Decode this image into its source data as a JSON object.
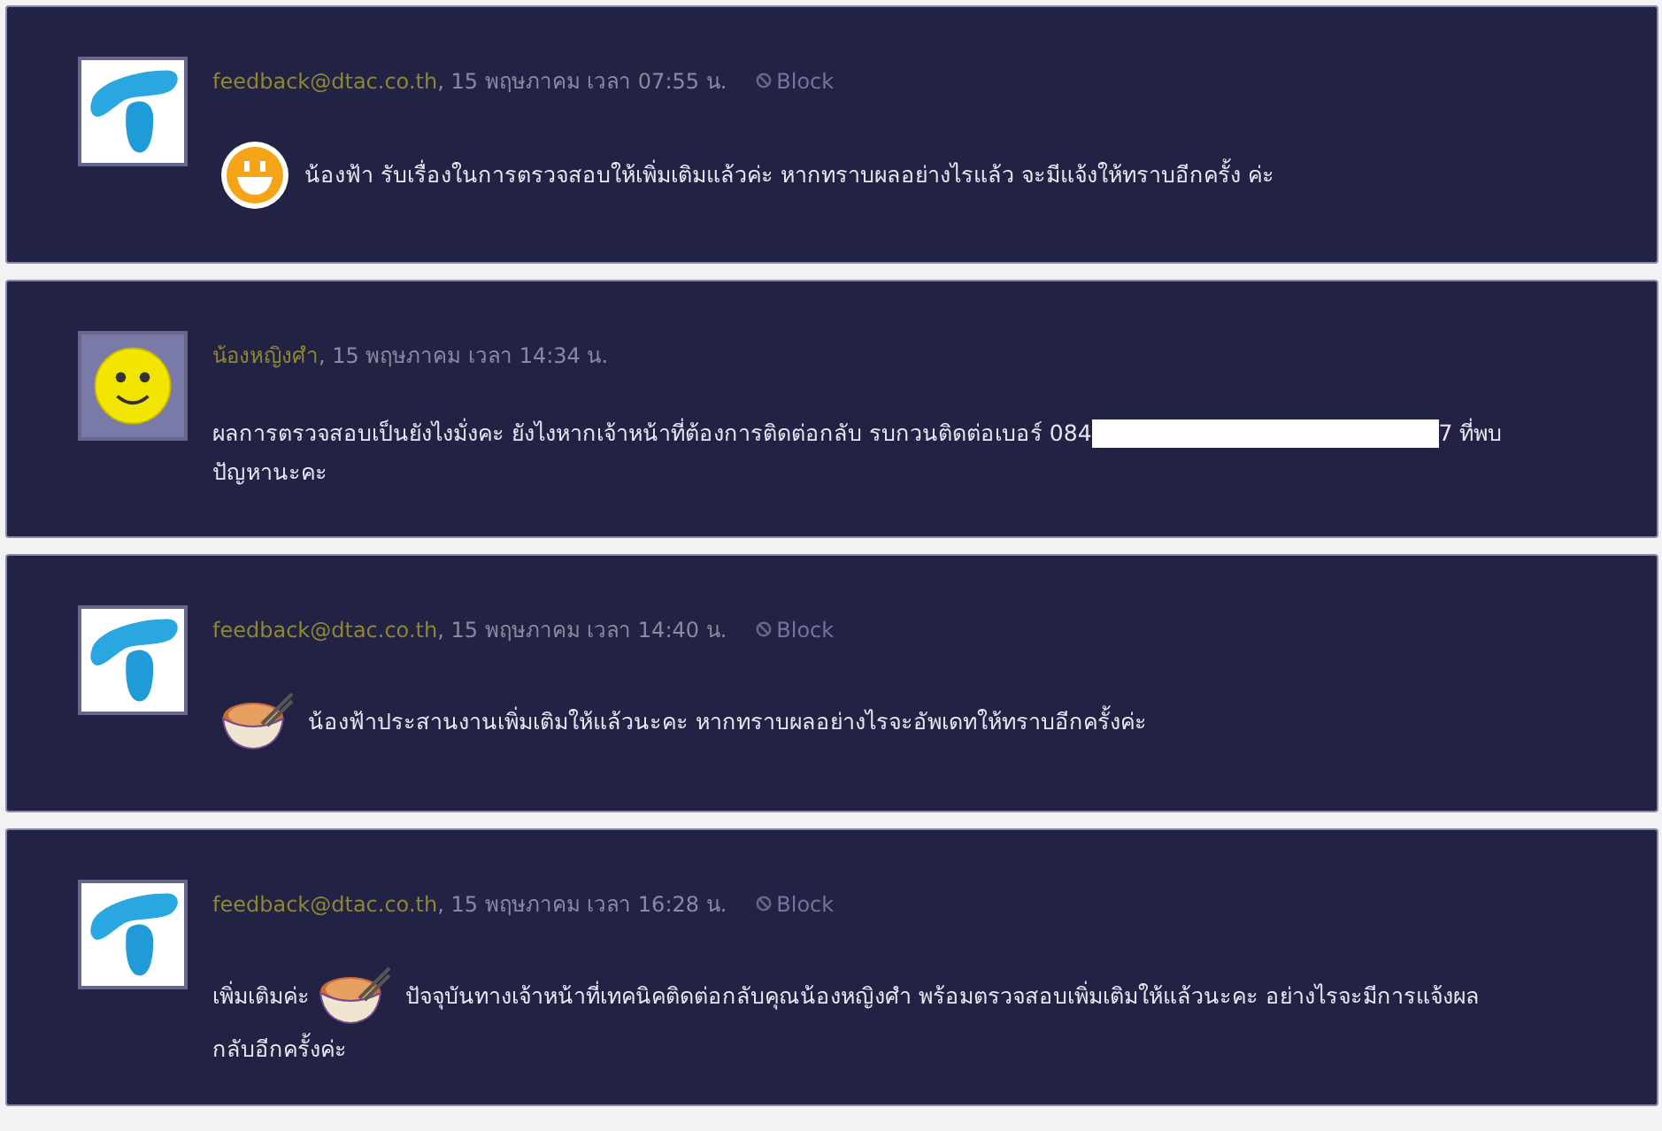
{
  "posts": [
    {
      "avatar": {
        "kind": "logo"
      },
      "author": "feedback@dtac.co.th",
      "date": ", 15 พฤษภาคม เวลา 07:55 น.",
      "block": "Block",
      "lines": [
        [
          {
            "kind": "grin"
          },
          {
            "kind": "text",
            "text": "น้องฟ้า รับเรื่องในการตรวจสอบให้เพิ่มเติมแล้วค่ะ หากทราบผลอย่างไรแล้ว จะมีแจ้งให้ทราบอีกครั้ง ค่ะ"
          }
        ]
      ]
    },
    {
      "avatar": {
        "kind": "smiley"
      },
      "author": "น้องหญิงศำ",
      "date": ", 15 พฤษภาคม เวลา 14:34 น.",
      "lines": [
        [
          {
            "kind": "text",
            "text": "ผลการตรวจสอบเป็นยังไงมั่งคะ ยังไงหากเจ้าหน้าที่ต้องการติดต่อกลับ รบกวนติดต่อเบอร์ 084"
          },
          {
            "kind": "redacted"
          },
          {
            "kind": "text",
            "text": "7 ที่พบ"
          }
        ],
        [
          {
            "kind": "text",
            "text": "ปัญหานะคะ"
          }
        ]
      ]
    },
    {
      "avatar": {
        "kind": "logo"
      },
      "author": "feedback@dtac.co.th",
      "date": ", 15 พฤษภาคม เวลา 14:40 น.",
      "block": "Block",
      "lines": [
        [
          {
            "kind": "noodle"
          },
          {
            "kind": "text",
            "text": "น้องฟ้าประสานงานเพิ่มเติมให้แล้วนะคะ หากทราบผลอย่างไรจะอัพเดทให้ทราบอีกครั้งค่ะ"
          }
        ]
      ]
    },
    {
      "avatar": {
        "kind": "logo"
      },
      "author": "feedback@dtac.co.th",
      "date": ", 15 พฤษภาคม เวลา 16:28 น.",
      "block": "Block",
      "lines": [
        [
          {
            "kind": "text",
            "text": "เพิ่มเติมค่ะ"
          },
          {
            "kind": "noodle"
          },
          {
            "kind": "text",
            "text": "ปัจจุบันทางเจ้าหน้าที่เทคนิคติดต่อกลับคุณน้องหญิงศำ พร้อมตรวจสอบเพิ่มเติมให้แล้วนะคะ อย่างไรจะมีการแจ้งผล"
          }
        ],
        [
          {
            "kind": "text",
            "text": "กลับอีกครั้งค่ะ"
          }
        ]
      ]
    }
  ]
}
